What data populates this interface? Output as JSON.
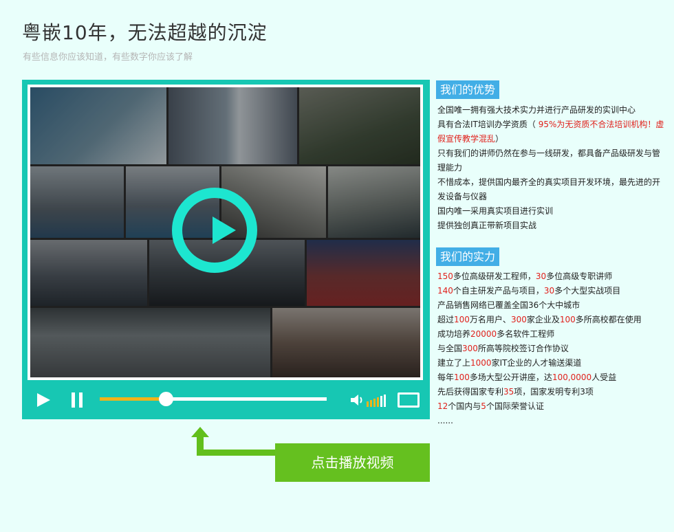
{
  "header": {
    "title": "粤嵌10年，无法超越的沉淀",
    "subtitle": "有些信息你应该知道，有些数字你应该了解"
  },
  "player": {
    "progress_fraction": 0.29,
    "volume_fraction": 0.6,
    "colors": {
      "frame": "#17c7b3",
      "play_ring": "#1de6d0",
      "progress": "#f0b419"
    }
  },
  "cta": {
    "label": "点击播放视频"
  },
  "advantages": {
    "heading": "我们的优势",
    "items": [
      {
        "parts": [
          {
            "t": "全国唯一拥有强大技术实力并进行产品研发的实训中心"
          }
        ]
      },
      {
        "parts": [
          {
            "t": "具有合法IT培训办学资质（ "
          },
          {
            "t": "95%为无资质不合法培训机构！虚假宣传教学混乱",
            "red": true
          },
          {
            "t": "）"
          }
        ]
      },
      {
        "parts": [
          {
            "t": "只有我们的讲师仍然在参与一线研发，都具备产品级研发与管理能力"
          }
        ]
      },
      {
        "parts": [
          {
            "t": "不惜成本，提供国内最齐全的真实项目开发环境，最先进的开发设备与仪器"
          }
        ]
      },
      {
        "parts": [
          {
            "t": "国内唯一采用真实项目进行实训"
          }
        ]
      },
      {
        "parts": [
          {
            "t": "提供独创真正带新项目实战"
          }
        ]
      }
    ]
  },
  "strengths": {
    "heading": "我们的实力",
    "items": [
      {
        "parts": [
          {
            "t": "150",
            "red": true
          },
          {
            "t": "多位高级研发工程师，"
          },
          {
            "t": "30",
            "red": true
          },
          {
            "t": "多位高级专职讲师"
          }
        ]
      },
      {
        "parts": [
          {
            "t": "140",
            "red": true
          },
          {
            "t": "个自主研发产品与项目，"
          },
          {
            "t": "30",
            "red": true
          },
          {
            "t": "多个大型实战项目"
          }
        ]
      },
      {
        "parts": [
          {
            "t": "产品销售网络已覆盖全国36个大中城市"
          }
        ]
      },
      {
        "parts": [
          {
            "t": "超过"
          },
          {
            "t": "100",
            "red": true
          },
          {
            "t": "万名用户、"
          },
          {
            "t": "300",
            "red": true
          },
          {
            "t": "家企业及"
          },
          {
            "t": "100",
            "red": true
          },
          {
            "t": "多所高校都在使用"
          }
        ]
      },
      {
        "parts": [
          {
            "t": "成功培养"
          },
          {
            "t": "20000",
            "red": true
          },
          {
            "t": "多名软件工程师"
          }
        ]
      },
      {
        "parts": [
          {
            "t": "与全国"
          },
          {
            "t": "300",
            "red": true
          },
          {
            "t": "所高等院校签订合作协议"
          }
        ]
      },
      {
        "parts": [
          {
            "t": "建立了上"
          },
          {
            "t": "1000",
            "red": true
          },
          {
            "t": "家IT企业的人才输送渠道"
          }
        ]
      },
      {
        "parts": [
          {
            "t": "每年"
          },
          {
            "t": "100",
            "red": true
          },
          {
            "t": "多场大型公开讲座，达"
          },
          {
            "t": "100,0000",
            "red": true
          },
          {
            "t": "人受益"
          }
        ]
      },
      {
        "parts": [
          {
            "t": "先后获得国家专利"
          },
          {
            "t": "35",
            "red": true
          },
          {
            "t": "项，国家发明专利3项"
          }
        ]
      },
      {
        "parts": [
          {
            "t": "12",
            "red": true
          },
          {
            "t": "个国内与"
          },
          {
            "t": "5",
            "red": true
          },
          {
            "t": "个国际荣誉认证"
          }
        ]
      },
      {
        "parts": [
          {
            "t": "......"
          }
        ]
      }
    ]
  }
}
